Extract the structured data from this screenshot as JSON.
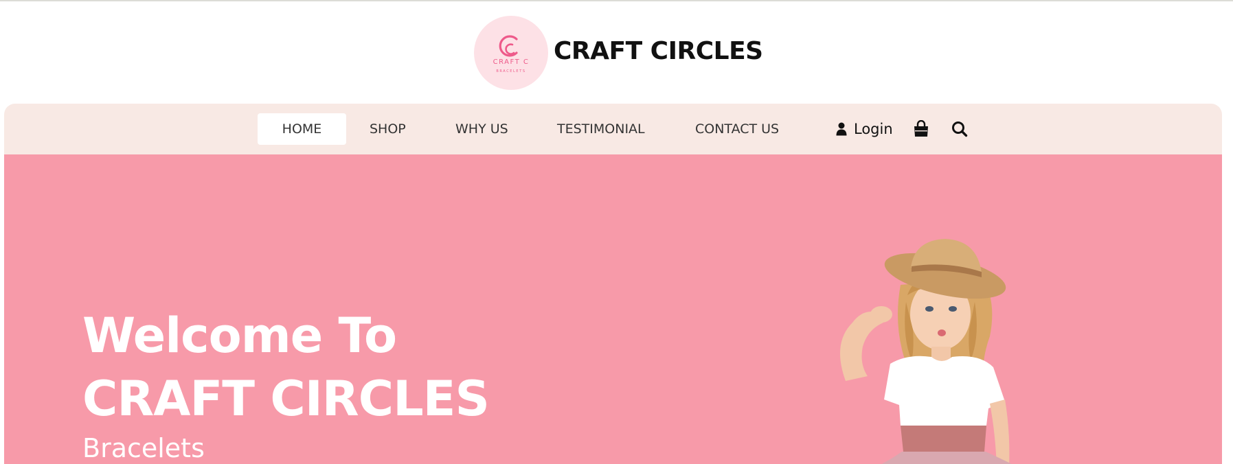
{
  "brand": {
    "name": "CRAFT CIRCLES",
    "logo_text": "CRAFT C",
    "logo_subtext": "BRACELETS"
  },
  "nav": {
    "items": [
      {
        "label": "HOME",
        "active": true
      },
      {
        "label": "SHOP",
        "active": false
      },
      {
        "label": "WHY US",
        "active": false
      },
      {
        "label": "TESTIMONIAL",
        "active": false
      },
      {
        "label": "CONTACT US",
        "active": false
      }
    ],
    "login_label": "Login",
    "icons": [
      "user-icon",
      "shopping-bag-icon",
      "search-icon"
    ]
  },
  "hero": {
    "title_line1": "Welcome To",
    "title_line2": "CRAFT CIRCLES",
    "subtitle": "Bracelets"
  },
  "colors": {
    "hero_bg": "#f79aa9",
    "nav_bg": "#f8e9e4",
    "logo_bg": "#fde1e6",
    "accent_pink": "#ee5a8a",
    "text_dark": "#111111"
  }
}
